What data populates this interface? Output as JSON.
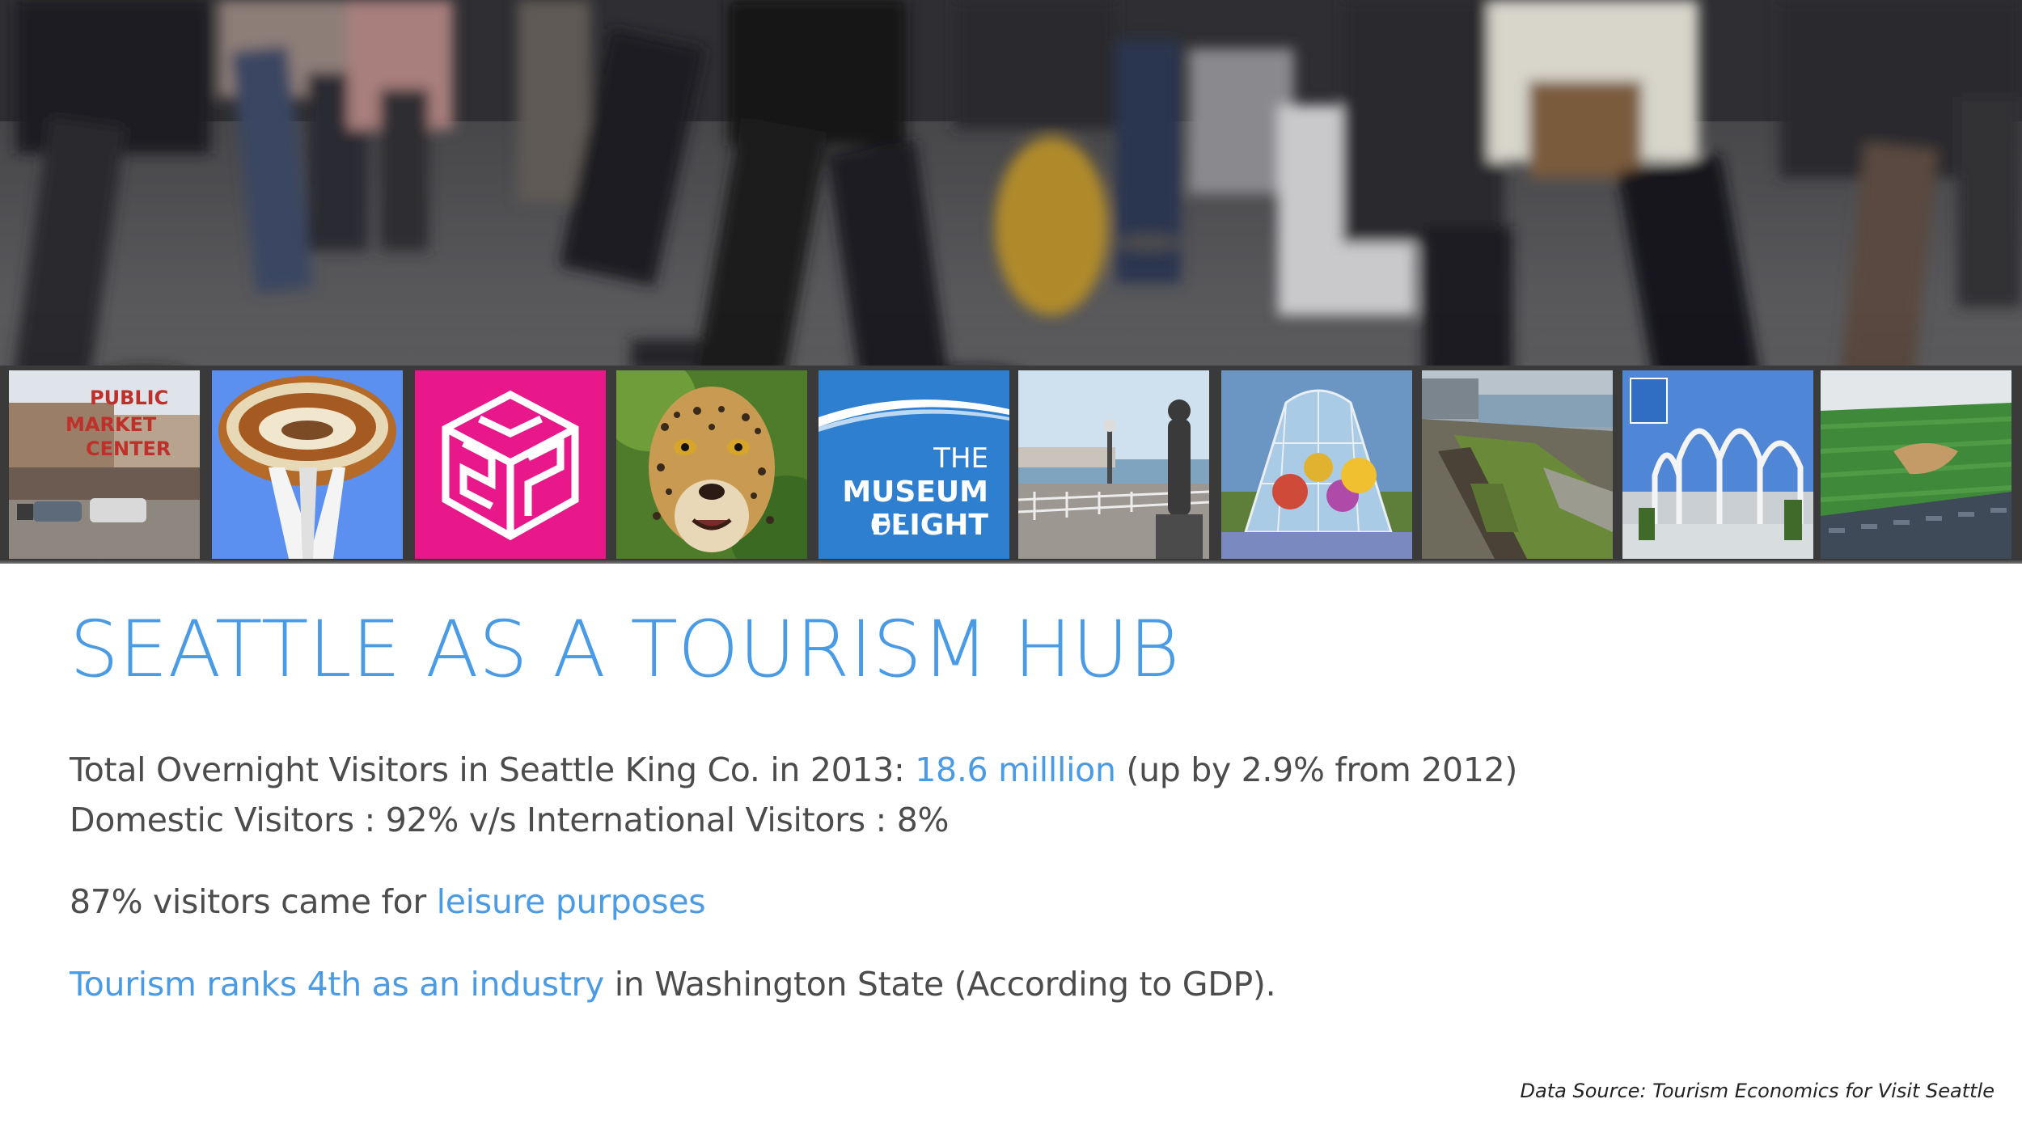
{
  "hero": {
    "photo": "crowd-of-pedestrians-walking-photo"
  },
  "thumbnails": [
    {
      "subject": "pike-place-public-market-sign",
      "sign_text": [
        "PUBLIC",
        "MARKET",
        "CENTER"
      ]
    },
    {
      "subject": "space-needle"
    },
    {
      "subject": "emp-museum-logo",
      "logo_color": "#e8178a"
    },
    {
      "subject": "cheetah-zoo"
    },
    {
      "subject": "museum-of-flight-logo",
      "line1": "THE",
      "line2": "MUSEUM",
      "line3": "OF",
      "line4": "FLIGHT",
      "logo_color": "#2f7fd0"
    },
    {
      "subject": "waterfront-pier-statue"
    },
    {
      "subject": "chihuly-glass-house"
    },
    {
      "subject": "olympic-sculpture-park-aerial"
    },
    {
      "subject": "pacific-science-center-arches"
    },
    {
      "subject": "safeco-baseball-field"
    }
  ],
  "slide": {
    "title": "SEATTLE AS A TOURISM HUB",
    "line1": {
      "prefix": "Total Overnight Visitors in Seattle King Co. in 2013: ",
      "highlight": "18.6 milllion",
      "suffix": " (up by 2.9% from 2012)"
    },
    "line2": "Domestic Visitors : 92% v/s International Visitors : 8%",
    "line3": {
      "prefix": "87% visitors came for ",
      "highlight": "leisure purposes"
    },
    "line4": {
      "highlight": "Tourism ranks 4th as an industry",
      "suffix": " in Washington State (According to GDP)."
    },
    "source": "Data Source: Tourism Economics for Visit Seattle"
  },
  "colors": {
    "accent": "#4a9be6",
    "body_text": "#4c4c4c",
    "background": "#ffffff"
  }
}
